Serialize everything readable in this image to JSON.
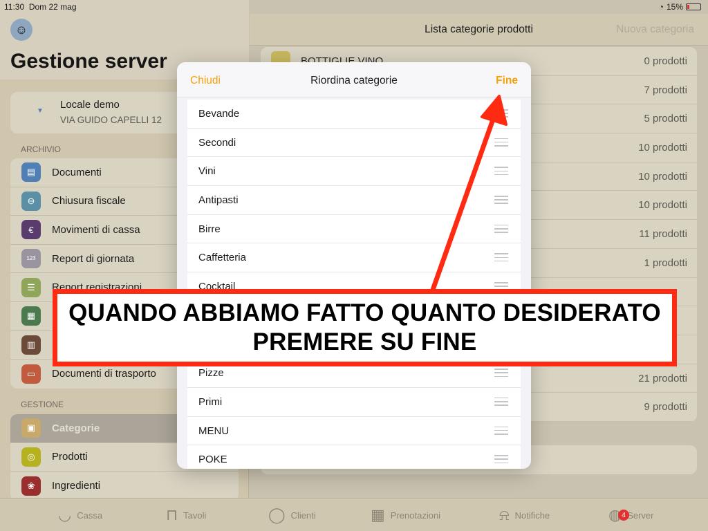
{
  "status": {
    "time": "11:30",
    "date": "Dom 22 mag",
    "battery": "15%"
  },
  "sidebar": {
    "title": "Gestione server",
    "venue": {
      "name": "Locale demo",
      "address": "VIA GUIDO CAPELLI 12"
    },
    "archivio_label": "ARCHIVIO",
    "archivio_items": [
      {
        "label": "Documenti",
        "icon": "folder-icon",
        "color": "#4f7fb5"
      },
      {
        "label": "Chiusura fiscale",
        "icon": "minus-circle-icon",
        "color": "#5a8fa6"
      },
      {
        "label": "Movimenti di cassa",
        "icon": "euro-icon",
        "color": "#5a3b6e"
      },
      {
        "label": "Report di giornata",
        "icon": "numbers-icon",
        "color": "#9a93a0"
      },
      {
        "label": "Report registrazioni",
        "icon": "list-icon",
        "color": "#8fa55a"
      },
      {
        "label": "",
        "icon": "register-icon",
        "color": "#4b7a4e"
      },
      {
        "label": "",
        "icon": "receipt-icon",
        "color": "#6b4a3a"
      },
      {
        "label": "Documenti di trasporto",
        "icon": "truck-icon",
        "color": "#c25a3e"
      }
    ],
    "gestione_label": "GESTIONE",
    "gestione_items": [
      {
        "label": "Categorie",
        "icon": "squares-icon",
        "color": "#c9a96a",
        "selected": true
      },
      {
        "label": "Prodotti",
        "icon": "ring-icon",
        "color": "#b6b11e"
      },
      {
        "label": "Ingredienti",
        "icon": "circles-icon",
        "color": "#9a2d2d"
      }
    ]
  },
  "main": {
    "title": "Lista categorie prodotti",
    "new_category": "Nuova categoria",
    "rows": [
      {
        "name": "BOTTIGLIE VINO",
        "count": "0 prodotti"
      },
      {
        "name": "",
        "count": "7 prodotti"
      },
      {
        "name": "",
        "count": "5 prodotti"
      },
      {
        "name": "",
        "count": "10 prodotti"
      },
      {
        "name": "",
        "count": "10 prodotti"
      },
      {
        "name": "",
        "count": "10 prodotti"
      },
      {
        "name": "",
        "count": "11 prodotti"
      },
      {
        "name": "",
        "count": "1 prodotti"
      },
      {
        "name": "",
        "count": ""
      },
      {
        "name": "",
        "count": ""
      },
      {
        "name": "",
        "count": ""
      },
      {
        "name": "",
        "count": "21 prodotti"
      },
      {
        "name": "",
        "count": "9 prodotti"
      }
    ]
  },
  "tabbar": [
    {
      "label": "Cassa",
      "icon": "basket-icon"
    },
    {
      "label": "Tavoli",
      "icon": "table-icon"
    },
    {
      "label": "Clienti",
      "icon": "person-icon"
    },
    {
      "label": "Prenotazioni",
      "icon": "calendar-icon"
    },
    {
      "label": "Notifiche",
      "icon": "bell-icon"
    },
    {
      "label": "Server",
      "icon": "globe-icon",
      "badge": "4"
    }
  ],
  "modal": {
    "close": "Chiudi",
    "title": "Riordina categorie",
    "done": "Fine",
    "items": [
      "Bevande",
      "Secondi",
      "Vini",
      "Antipasti",
      "Birre",
      "Caffetteria",
      "Cocktail",
      "",
      "",
      "Pizze",
      "Primi",
      "MENU",
      "POKE"
    ]
  },
  "annotation": {
    "line1": "QUANDO ABBIAMO FATTO QUANTO DESIDERATO",
    "line2": "PREMERE SU FINE",
    "color": "#ff2a12"
  }
}
